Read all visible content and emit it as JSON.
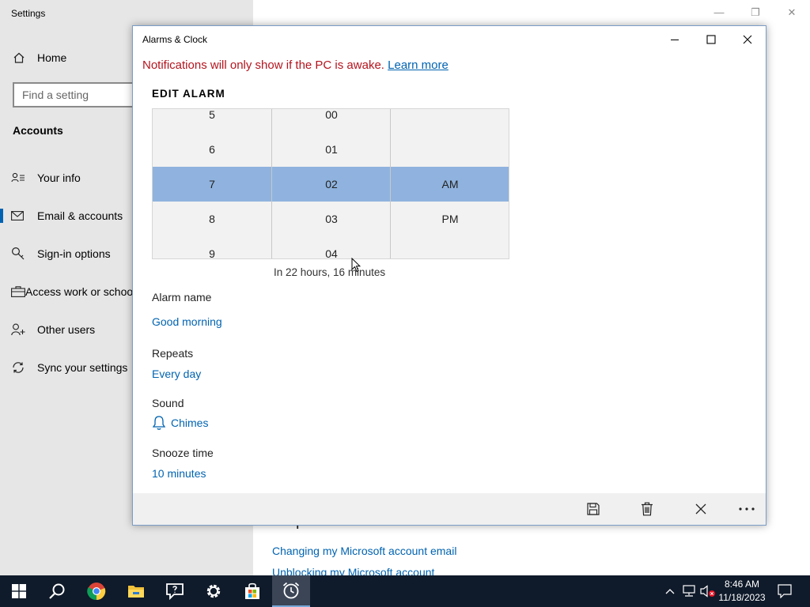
{
  "settings": {
    "title": "Settings",
    "home_label": "Home",
    "search_placeholder": "Find a setting",
    "section_title": "Accounts",
    "nav_items": [
      {
        "label": "Your info",
        "icon": "person-card-icon"
      },
      {
        "label": "Email & accounts",
        "icon": "mail-icon"
      },
      {
        "label": "Sign-in options",
        "icon": "key-icon"
      },
      {
        "label": "Access work or school",
        "icon": "briefcase-icon"
      },
      {
        "label": "Other users",
        "icon": "person-add-icon"
      },
      {
        "label": "Sync your settings",
        "icon": "sync-icon"
      }
    ],
    "selected_nav": "Email & accounts",
    "main_heading": "Help from the web",
    "links": [
      "Changing my Microsoft account email",
      "Unblocking my Microsoft account"
    ]
  },
  "alarm_window": {
    "title": "Alarms & Clock",
    "notice_text": "Notifications will only show if the PC is awake.",
    "notice_link": "Learn more",
    "edit_heading": "EDIT ALARM",
    "picker": {
      "hours": [
        "5",
        "6",
        "7",
        "8",
        "9"
      ],
      "minutes": [
        "00",
        "01",
        "02",
        "03",
        "04"
      ],
      "periods": [
        "AM",
        "PM"
      ],
      "selected_hour": "7",
      "selected_minute": "02",
      "selected_period": "AM"
    },
    "countdown": "In 22 hours, 16 minutes",
    "fields": {
      "name_label": "Alarm name",
      "name_value": "Good morning",
      "repeats_label": "Repeats",
      "repeats_value": "Every day",
      "sound_label": "Sound",
      "sound_value": "Chimes",
      "snooze_label": "Snooze time",
      "snooze_value": "10 minutes"
    },
    "commands": [
      "save-icon",
      "delete-icon",
      "close-icon",
      "more-icon"
    ]
  },
  "taskbar": {
    "apps": [
      "start-icon",
      "search-icon",
      "chrome-icon",
      "file-explorer-icon",
      "feedback-hub-icon",
      "settings-icon",
      "store-icon",
      "alarms-clock-icon"
    ],
    "active_app": "alarms-clock-icon",
    "time": "8:46 AM",
    "date": "11/18/2023"
  },
  "colors": {
    "accent": "#0063b1",
    "selection": "#8fb3de",
    "notice": "#b4141e",
    "taskbar": "#0f1a2a"
  }
}
